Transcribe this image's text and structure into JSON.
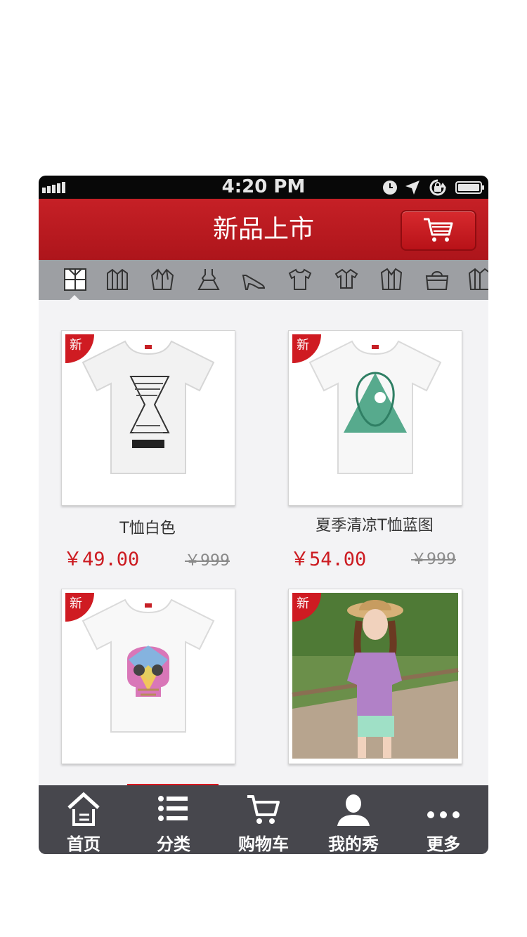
{
  "status_bar": {
    "time": "4:20 PM"
  },
  "header": {
    "title": "新品上市"
  },
  "categories": [
    {
      "name": "all-icon"
    },
    {
      "name": "coat-icon"
    },
    {
      "name": "jacket-icon"
    },
    {
      "name": "dress-icon"
    },
    {
      "name": "heels-icon"
    },
    {
      "name": "tee-icon"
    },
    {
      "name": "shirt-icon"
    },
    {
      "name": "cardigan-icon"
    },
    {
      "name": "handbag-icon"
    },
    {
      "name": "sweater-icon"
    }
  ],
  "products": [
    {
      "tag": "新",
      "name": "T恤白色",
      "price": "￥49.00",
      "old_price": "￥999"
    },
    {
      "tag": "新",
      "name": "夏季清凉T恤蓝图",
      "price": "￥54.00",
      "old_price": "￥999"
    },
    {
      "tag": "新"
    },
    {
      "tag": "新"
    }
  ],
  "tabbar": {
    "items": [
      {
        "label": "首页",
        "icon": "home-icon"
      },
      {
        "label": "分类",
        "icon": "list-icon"
      },
      {
        "label": "购物车",
        "icon": "cart-icon"
      },
      {
        "label": "我的秀",
        "icon": "user-icon"
      },
      {
        "label": "更多",
        "icon": "more-icon"
      }
    ]
  },
  "colors": {
    "brand_red": "#c62026",
    "tabbar": "#47474d",
    "category_bar": "#9d9fa3"
  }
}
